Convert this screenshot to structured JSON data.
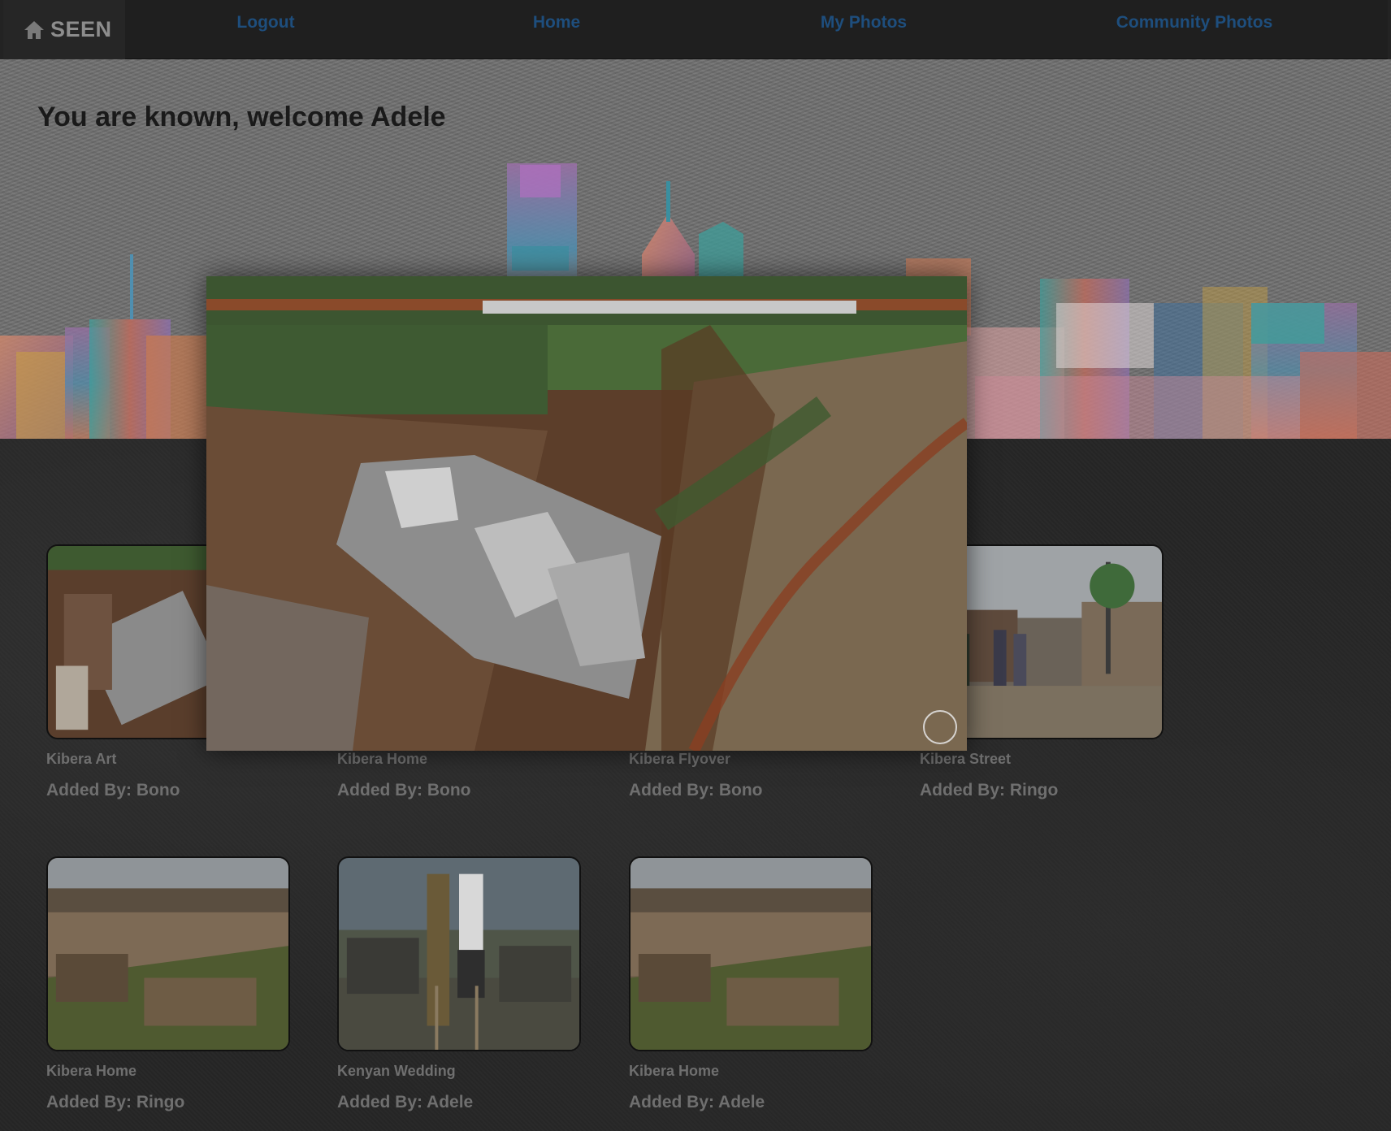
{
  "nav": {
    "brand": "SEEN",
    "brand_icon": "home-icon",
    "links": [
      "Logout",
      "Home",
      "My Photos",
      "Community Photos"
    ],
    "link_color": "#1e4e7d"
  },
  "hero": {
    "welcome": "You are known, welcome Adele"
  },
  "modal": {
    "photo": "Kibera Flyover",
    "signature_icon": "signature-icon"
  },
  "photos": [
    {
      "title": "Kibera Art",
      "added_by": "Added By: Bono"
    },
    {
      "title": "Kibera Home",
      "added_by": "Added By: Bono"
    },
    {
      "title": "Kibera Flyover",
      "added_by": "Added By: Bono"
    },
    {
      "title": "Kibera Street",
      "added_by": "Added By: Ringo"
    },
    {
      "title": "Kibera Home",
      "added_by": "Added By: Ringo"
    },
    {
      "title": "Kenyan Wedding",
      "added_by": "Added By: Adele"
    },
    {
      "title": "Kibera Home",
      "added_by": "Added By: Adele"
    }
  ]
}
